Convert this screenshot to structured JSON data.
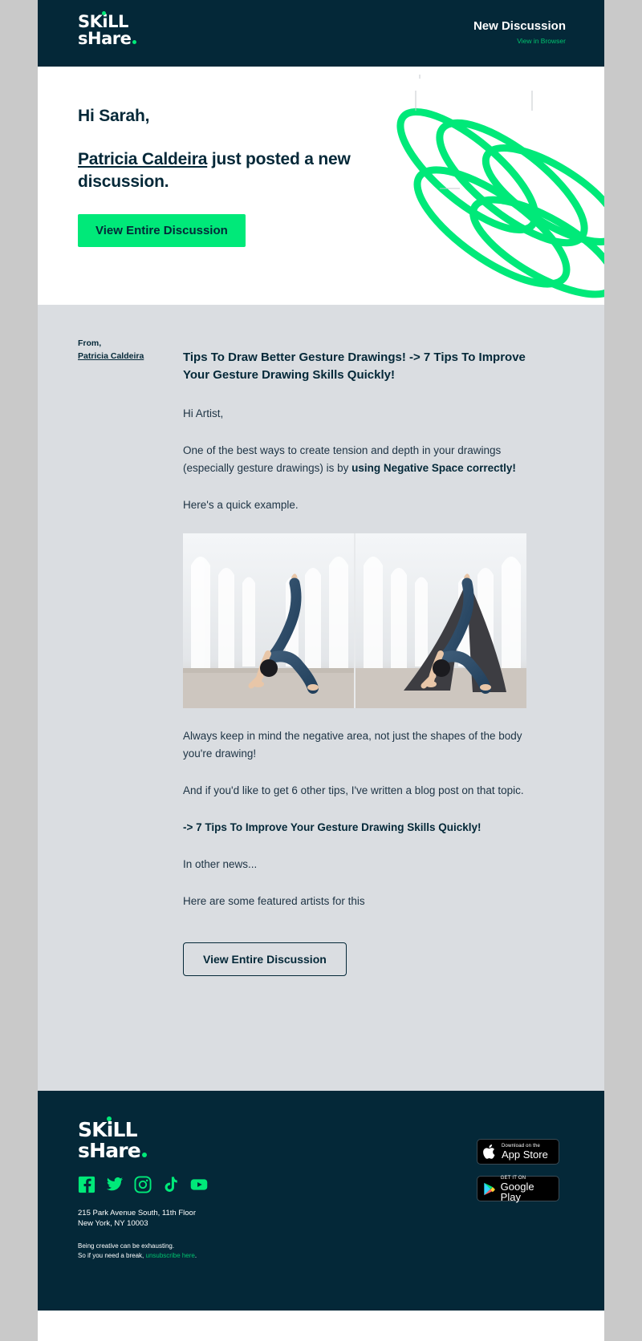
{
  "brand": {
    "name_line1": "SKiLL",
    "name_line2": "sHare",
    "accent_green": "#00e979",
    "dark_navy": "#042838",
    "body_bg": "#dadde1"
  },
  "header": {
    "title": "New Discussion",
    "browser_link": "View in Browser"
  },
  "hero": {
    "greeting": "Hi Sarah,",
    "author": "Patricia Caldeira",
    "headline_rest": " just posted a new discussion.",
    "cta_label": "View Entire Discussion"
  },
  "from": {
    "label": "From,",
    "name": "Patricia Caldeira"
  },
  "discussion": {
    "title": "Tips To Draw Better Gesture Drawings! -> 7 Tips To Improve Your Gesture Drawing Skills Quickly!",
    "p1": "Hi Artist,",
    "p2_plain": "One of the best ways to create tension and depth in your drawings (especially gesture drawings) is by ",
    "p2_bold": "using Negative Space correctly!",
    "p3": "Here's a quick example.",
    "image_alt": "Side-by-side photo of a woman in a yoga handstand pose, the right copy highlighting the negative space in dark grey",
    "p4": "Always keep in mind the negative area, not just the shapes of the body you're drawing!",
    "p5": "And if you'd like to get 6 other tips, I've written a blog post on that topic.",
    "p6_bold": "-> 7 Tips To Improve Your Gesture Drawing Skills Quickly!",
    "p7": "In other news...",
    "p8": "Here are some featured artists for this",
    "cta_label": "View Entire Discussion"
  },
  "footer": {
    "socials": [
      {
        "name": "facebook-icon",
        "label": "Facebook"
      },
      {
        "name": "twitter-icon",
        "label": "Twitter"
      },
      {
        "name": "instagram-icon",
        "label": "Instagram"
      },
      {
        "name": "tiktok-icon",
        "label": "TikTok"
      },
      {
        "name": "youtube-icon",
        "label": "YouTube"
      }
    ],
    "address_line1": "215 Park Avenue South, 11th Floor",
    "address_line2": "New York, NY 10003",
    "legal_line1": "Being creative can be exhausting.",
    "legal_line2_pre": "So if you need a break, ",
    "legal_unsub": "unsubscribe here",
    "legal_line2_post": ".",
    "appstore_small": "Download on the",
    "appstore_big": "App Store",
    "googleplay_small": "GET IT ON",
    "googleplay_big": "Google Play"
  }
}
